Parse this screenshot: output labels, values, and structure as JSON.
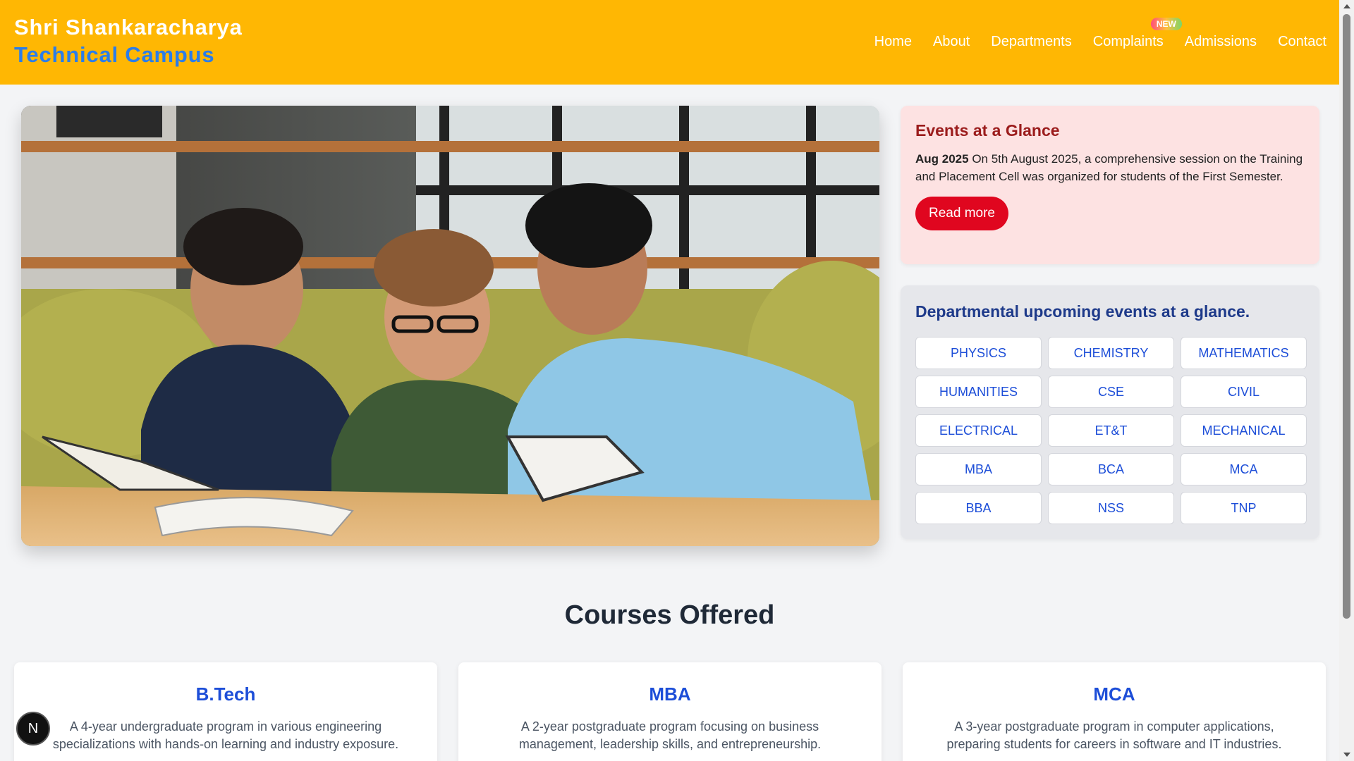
{
  "header": {
    "brand_line1": "Shri Shankaracharya",
    "brand_line2": "Technical Campus",
    "nav": [
      "Home",
      "About",
      "Departments",
      "Complaints",
      "Admissions",
      "Contact"
    ],
    "new_badge": "NEW"
  },
  "events": {
    "title": "Events at a Glance",
    "date": "Aug 2025",
    "text": " On 5th August 2025, a comprehensive session on the Training and Placement Cell was organized for students of the First Semester.",
    "read_more": "Read more"
  },
  "departments": {
    "title": "Departmental upcoming events at a glance.",
    "items": [
      "PHYSICS",
      "CHEMISTRY",
      "MATHEMATICS",
      "HUMANITIES",
      "CSE",
      "CIVIL",
      "ELECTRICAL",
      "ET&T",
      "MECHANICAL",
      "MBA",
      "BCA",
      "MCA",
      "BBA",
      "NSS",
      "TNP"
    ]
  },
  "courses": {
    "title": "Courses Offered",
    "items": [
      {
        "name": "B.Tech",
        "desc": "A 4-year undergraduate program in various engineering specializations with hands-on learning and industry exposure."
      },
      {
        "name": "MBA",
        "desc": "A 2-year postgraduate program focusing on business management, leadership skills, and entrepreneurship."
      },
      {
        "name": "MCA",
        "desc": "A 3-year postgraduate program in computer applications, preparing students for careers in software and IT industries."
      }
    ]
  },
  "fab_label": "N",
  "colors": {
    "header_bg": "#ffb703",
    "brand_blue": "#2b7de9",
    "events_bg": "#fde2e2",
    "events_title": "#9b1c1c",
    "read_more_bg": "#e0061f",
    "dept_text": "#1d4ed8"
  }
}
